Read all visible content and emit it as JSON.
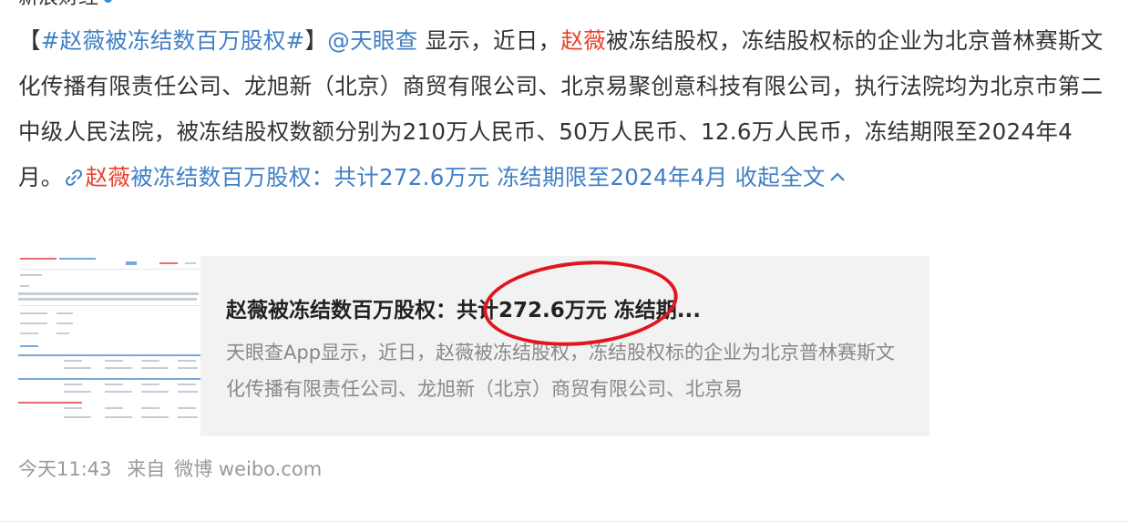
{
  "author": {
    "name": "新浪财经"
  },
  "post": {
    "p1": "【",
    "hashtag": "#赵薇被冻结数百万股权#",
    "p2": "】",
    "mention": "@天眼查",
    "p3": " 显示，近日，",
    "name1": "赵薇",
    "p4": "被冻结股权，冻结股权标的企业为北京普林赛斯文化传播有限责任公司、龙旭新（北京）商贸有限公司、北京易聚创意科技有限公司，执行法院均为北京市第二中级人民法院，被冻结股权数额分别为210万人民币、50万人民币、12.6万人民币，冻结期限至2024年4月。",
    "link_name": "赵薇",
    "link_rest": "被冻结数百万股权：共计272.6万元 冻结期限至2024年4月",
    "collapse_label": "收起全文"
  },
  "card": {
    "title": "赵薇被冻结数百万股权：共计272.6万元 冻结期...",
    "description": "天眼查App显示，近日，赵薇被冻结股权，冻结股权标的企业为北京普林赛斯文化传播有限责任公司、龙旭新（北京）商贸有限公司、北京易"
  },
  "footer": {
    "time": "今天11:43",
    "source_prefix": "来自",
    "source": "微博 weibo.com"
  },
  "colors": {
    "highlight_red": "#e8412b",
    "link_blue": "#3f7fc5",
    "circle_red": "#e0161f"
  },
  "icons": [
    "verified-badge-icon",
    "link-icon",
    "chevron-up-icon"
  ]
}
